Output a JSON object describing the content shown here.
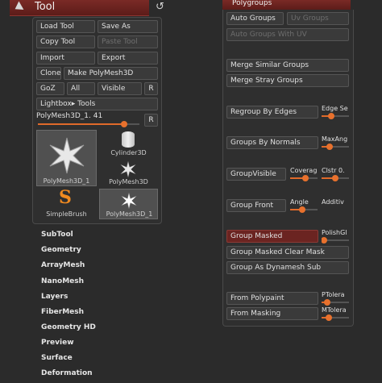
{
  "tool_palette": {
    "title": "Tool",
    "buttons": {
      "load_tool": "Load Tool",
      "save_as": "Save As",
      "copy_tool": "Copy Tool",
      "paste_tool": "Paste Tool",
      "import": "Import",
      "export": "Export",
      "clone": "Clone",
      "make_polymesh": "Make PolyMesh3D",
      "goz": "GoZ",
      "all": "All",
      "visible": "Visible",
      "r": "R",
      "lightbox_tools": "Lightbox▸ Tools",
      "r2": "R"
    },
    "current_tool": {
      "label": "PolyMesh3D_1. 41",
      "value": 41,
      "slider_fraction": 0.85
    },
    "thumbnails": [
      {
        "label": "PolyMesh3D_1",
        "icon": "star-icon",
        "selected": true
      },
      {
        "label": "Cylinder3D",
        "icon": "cylinder-icon",
        "selected": false
      },
      {
        "label": "PolyMesh3D",
        "icon": "star-icon",
        "selected": false
      },
      {
        "label": "SimpleBrush",
        "icon": "simplebrush-icon",
        "selected": false
      },
      {
        "label": "PolyMesh3D_1",
        "icon": "star-icon",
        "selected": true
      }
    ],
    "subpalettes": [
      "SubTool",
      "Geometry",
      "ArrayMesh",
      "NanoMesh",
      "Layers",
      "FiberMesh",
      "Geometry HD",
      "Preview",
      "Surface",
      "Deformation"
    ]
  },
  "polygroups": {
    "title": "Polygroups",
    "auto_groups": "Auto Groups",
    "uv_groups": "Uv Groups",
    "auto_groups_uv": "Auto Groups With UV",
    "merge_similar": "Merge Similar Groups",
    "merge_stray": "Merge Stray Groups",
    "regroup_by_edges": "Regroup By Edges",
    "edge_slider": "Edge Se",
    "groups_by_normals": "Groups By Normals",
    "maxang_slider": "MaxAng",
    "group_visible": "GroupVisible",
    "coverage_slider": "Coverag",
    "clstr_slider": "Clstr 0.",
    "group_front": "Group Front",
    "angle_slider": "Angle",
    "additive_slider": "Additiv",
    "group_masked": "Group Masked",
    "polishgl_slider": "PolishGl",
    "group_masked_clear": "Group Masked Clear Mask",
    "group_as_dynamesh": "Group As Dynamesh Sub",
    "from_polypaint": "From Polypaint",
    "ptolera_slider": "PTolera",
    "from_masking": "From Masking",
    "mtolera_slider": "MTolera",
    "slider_levels": {
      "edge": 0.35,
      "maxang": 0.3,
      "coverage": 0.55,
      "clstr": 0.5,
      "angle": 0.45,
      "polishgl": 0.1,
      "ptolera": 0.2,
      "mtolera": 0.25
    }
  },
  "colors": {
    "accent": "#e8712d",
    "header": "#6b2421",
    "background": "#2b2b2b"
  }
}
